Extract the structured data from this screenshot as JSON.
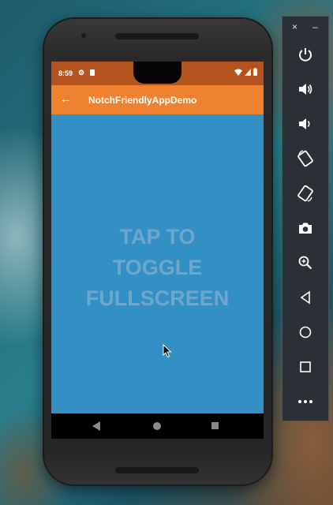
{
  "status_bar": {
    "time": "8:59",
    "icons": [
      "gear-icon",
      "sd-card-icon",
      "wifi-icon",
      "signal-icon",
      "battery-icon"
    ]
  },
  "app_bar": {
    "title": "NotchFriendlyAppDemo",
    "back_icon": "arrow-left-icon"
  },
  "content": {
    "lines": [
      "TAP TO",
      "TOGGLE",
      "FULLSCREEN"
    ]
  },
  "nav_bar": {
    "buttons": [
      "back",
      "home",
      "recents"
    ]
  },
  "toolbar": {
    "window_buttons": {
      "close": "×",
      "minimize": "–"
    },
    "buttons": [
      "power",
      "volume-up",
      "volume-down",
      "rotate-left",
      "rotate-right",
      "screenshot",
      "zoom",
      "back",
      "home",
      "overview",
      "more"
    ]
  },
  "colors": {
    "status_bar": "#b5531e",
    "app_bar": "#ee8231",
    "content_bg": "#3390c4",
    "content_text": "#7aaacd"
  }
}
